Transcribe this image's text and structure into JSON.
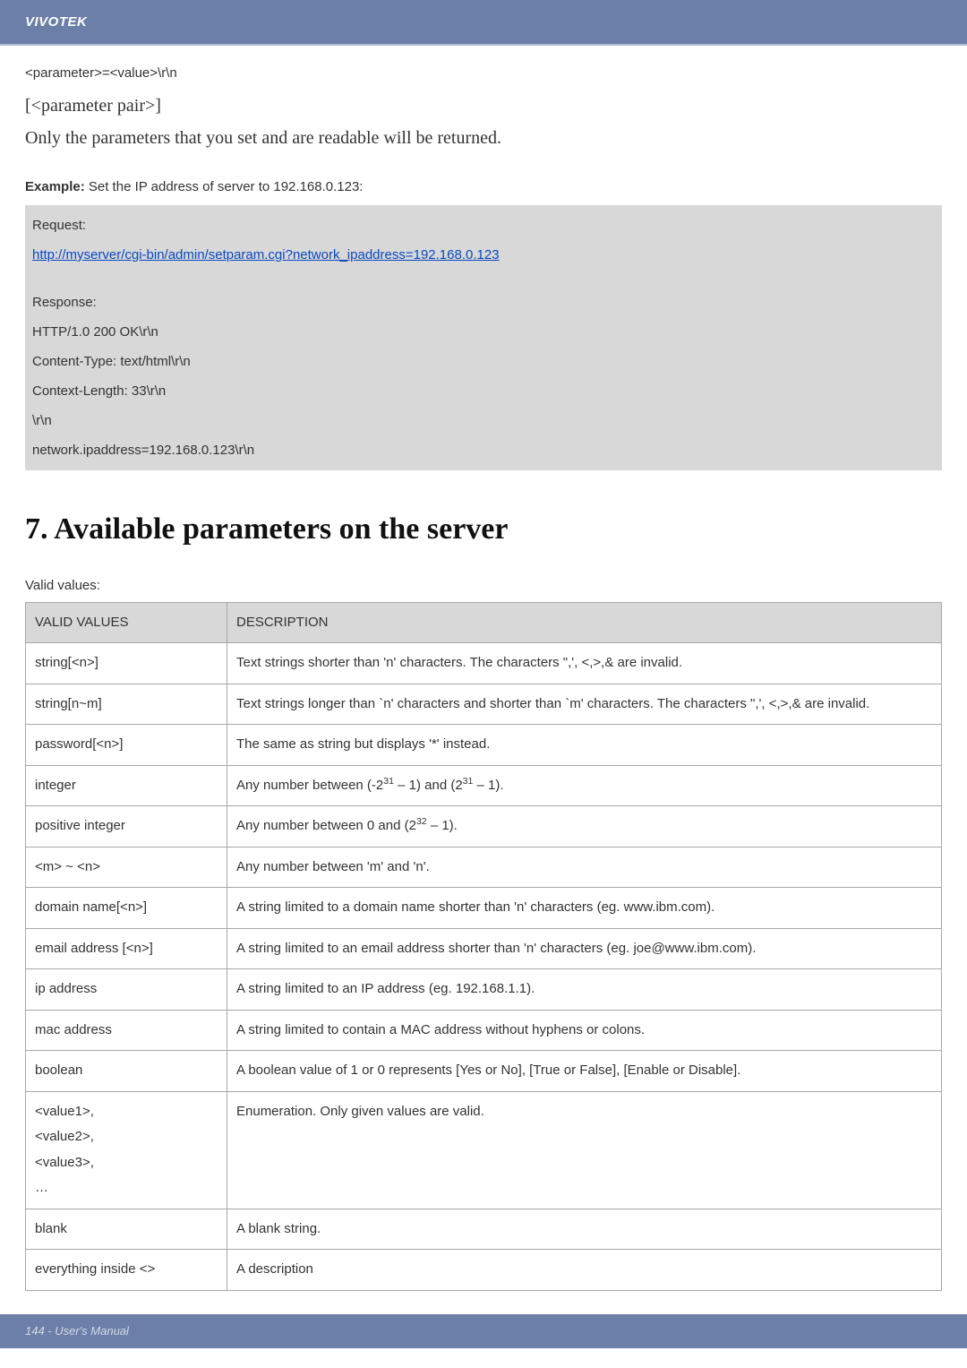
{
  "brand": "VIVOTEK",
  "pre_lines": {
    "l1": "<parameter>=<value>\\r\\n",
    "l2": "[<parameter pair>]",
    "l3": "Only the parameters that you set and are readable will be returned."
  },
  "example_label_bold": "Example:",
  "example_label_rest": " Set the IP address of server to 192.168.0.123:",
  "request_block": {
    "title": "Request:",
    "url": "http://myserver/cgi-bin/admin/setparam.cgi?network_ipaddress=192.168.0.123"
  },
  "response_block": {
    "title": "Response:",
    "l1": "HTTP/1.0 200 OK\\r\\n",
    "l2": "Content-Type: text/html\\r\\n",
    "l3": "Context-Length: 33\\r\\n",
    "l4": "\\r\\n",
    "l5": "network.ipaddress=192.168.0.123\\r\\n"
  },
  "heading": "7. Available parameters on the server",
  "valid_values_label": "Valid values:",
  "table": {
    "head": {
      "c1": "VALID VALUES",
      "c2": "DESCRIPTION"
    },
    "rows": [
      {
        "v": "string[<n>]",
        "d": "Text strings shorter than 'n' characters. The characters \",', <,>,& are invalid."
      },
      {
        "v": "string[n~m]",
        "d": "Text strings longer than `n' characters and shorter than `m' characters. The characters \",', <,>,& are invalid."
      },
      {
        "v": "password[<n>]",
        "d": "The same as string but displays '*' instead."
      },
      {
        "v": "integer",
        "d": "__INTEGER__"
      },
      {
        "v": "positive integer",
        "d": "__POSINT__"
      },
      {
        "v": "<m> ~ <n>",
        "d": "Any number between 'm' and 'n'."
      },
      {
        "v": "domain name[<n>]",
        "d": "A string limited to a domain name shorter than 'n' characters (eg. www.ibm.com)."
      },
      {
        "v": "email address [<n>]",
        "d": "A string limited to an email address shorter than 'n' characters (eg. joe@www.ibm.com)."
      },
      {
        "v": "ip address",
        "d": "A string limited to an IP address (eg. 192.168.1.1)."
      },
      {
        "v": "mac address",
        "d": "A string limited to contain a MAC address without hyphens or colons."
      },
      {
        "v": "boolean",
        "d": "A boolean value of 1 or 0 represents [Yes or No], [True or False], [Enable or Disable]."
      },
      {
        "v": "<value1>,\n<value2>,\n<value3>,\n…",
        "d": "Enumeration. Only given values are valid."
      },
      {
        "v": "blank",
        "d": "A blank string."
      },
      {
        "v": "everything inside <>",
        "d": "A description"
      }
    ],
    "integer_html": "Any number between (-2<sup>31</sup> – 1) and (2<sup>31</sup> – 1).",
    "posint_html": "Any number between 0 and (2<sup>32</sup> – 1)."
  },
  "footer": "144 - User's Manual"
}
